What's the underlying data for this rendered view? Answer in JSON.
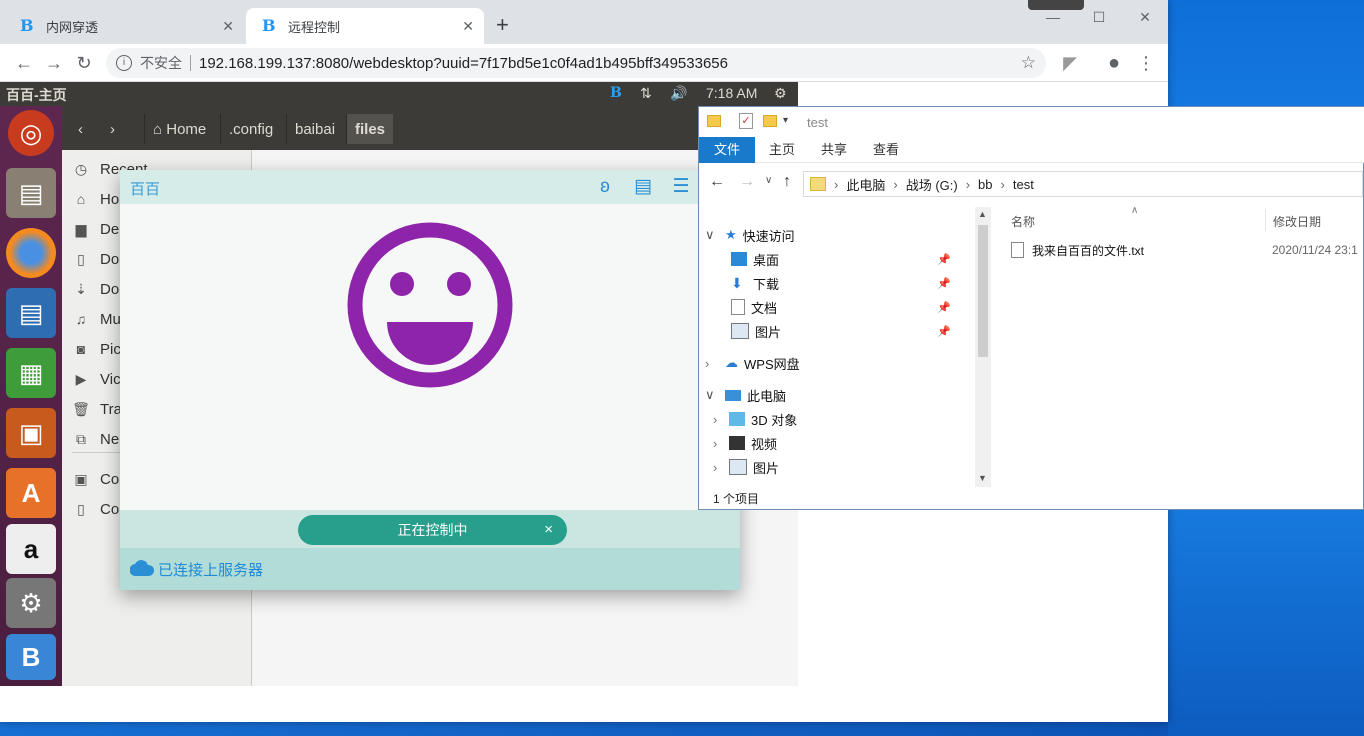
{
  "browser": {
    "tabs": [
      {
        "label": "内网穿透",
        "icon": "B"
      },
      {
        "label": "远程控制",
        "icon": "B"
      }
    ],
    "insecure_label": "不安全",
    "url": "192.168.199.137:8080/webdesktop?uuid=7f17bd5e1c0f4ad1b495bff349533656"
  },
  "ubuntu": {
    "window_title": "百百-主页",
    "clock": "7:18 AM",
    "path": [
      "Home",
      ".config",
      "baibai",
      "files"
    ],
    "sidebar": [
      "Recent",
      "Ho",
      "De",
      "Do",
      "Do",
      "Mu",
      "Pic",
      "Vic",
      "Tra",
      "Ne",
      "Co",
      "Co"
    ]
  },
  "app": {
    "title": "百百",
    "control_status": "正在控制中",
    "close_glyph": "×",
    "server_status": "已连接上服务器",
    "colors": {
      "smiley": "#8e24aa",
      "accent": "#26a08c"
    }
  },
  "explorer": {
    "title": "test",
    "ribbon": [
      "文件",
      "主页",
      "共享",
      "查看"
    ],
    "breadcrumb": [
      "此电脑",
      "战场 (G:)",
      "bb",
      "test"
    ],
    "tree": {
      "quick_access": "快速访问",
      "quick_items": [
        "桌面",
        "下载",
        "文档",
        "图片"
      ],
      "wps": "WPS网盘",
      "this_pc": "此电脑",
      "pc_items": [
        "3D 对象",
        "视频",
        "图片"
      ]
    },
    "columns": {
      "name": "名称",
      "modified": "修改日期"
    },
    "files": [
      {
        "name": "我来自百百的文件.txt",
        "modified": "2020/11/24 23:1"
      }
    ],
    "status": "1 个项目"
  }
}
